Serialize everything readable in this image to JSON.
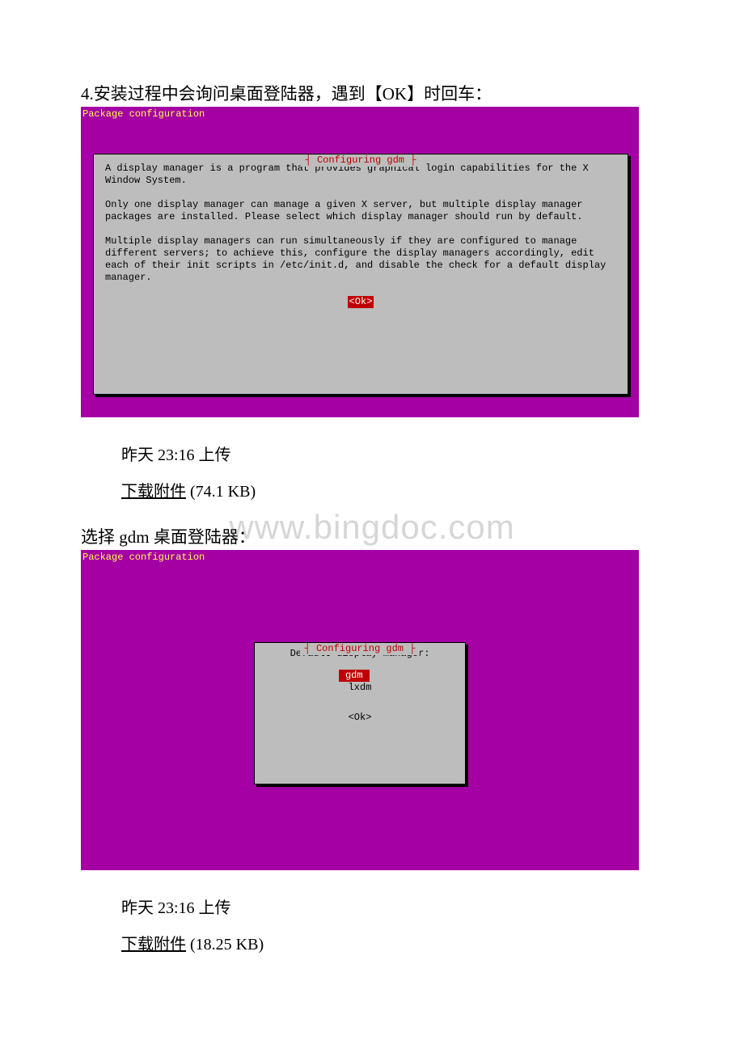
{
  "heading1": "4.安装过程中会询问桌面登陆器，遇到【OK】时回车：",
  "heading2": "选择 gdm 桌面登陆器：",
  "terminal": {
    "pkg_conf": "Package configuration",
    "dialog_title": "Configuring gdm",
    "para1": "A display manager is a program that provides graphical login capabilities for the X Window System.",
    "para2": "Only one display manager can manage a given X server, but multiple display manager packages are installed. Please select which display manager should run by default.",
    "para3": "Multiple display managers can run simultaneously if they are configured to manage different servers; to achieve this, configure the display managers accordingly, edit each of their init scripts in /etc/init.d, and disable the check for a default display manager.",
    "ok_label": "<Ok>",
    "select_prompt": "Default display manager:",
    "opt1": "gdm",
    "opt2": "lxdm"
  },
  "meta1": {
    "uploaded": "昨天 23:16 上传",
    "download_prefix": "下载附件",
    "download_size": " (74.1 KB)"
  },
  "meta2": {
    "uploaded": "昨天 23:16 上传",
    "download_prefix": "下载附件",
    "download_size": " (18.25 KB)"
  },
  "watermark": "www.bingdoc.com"
}
